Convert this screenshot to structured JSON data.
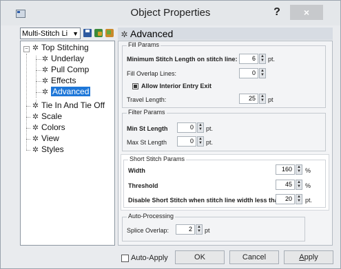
{
  "window": {
    "title": "Object Properties",
    "help_label": "?",
    "close_label": "×"
  },
  "left": {
    "combo_value": "Multi-Stitch Li",
    "tree": {
      "root": "Top Stitching",
      "children": [
        "Underlay",
        "Pull Comp",
        "Effects",
        "Advanced"
      ],
      "others": [
        "Tie In And Tie Off",
        "Scale",
        "Colors",
        "View",
        "Styles"
      ]
    }
  },
  "right": {
    "header": "Advanced",
    "fill_params": {
      "title": "Fill Params",
      "min_stitch_label": "Minimum Stitch Length on stitch line:",
      "min_stitch_value": "6",
      "min_stitch_unit": "pt.",
      "overlap_label": "Fill Overlap Lines:",
      "overlap_value": "0",
      "interior_label": "Allow Interior Entry Exit",
      "travel_label": "Travel Length:",
      "travel_value": "25",
      "travel_unit": "pt"
    },
    "filter_params": {
      "title": "Filter Params",
      "min_label": "Min St Length",
      "min_value": "0",
      "min_unit": "pt.",
      "max_label": "Max St Length",
      "max_value": "0",
      "max_unit": "pt."
    },
    "short_stitch": {
      "title": "Short Stitch Params",
      "width_label": "Width",
      "width_value": "160",
      "width_unit": "%",
      "threshold_label": "Threshold",
      "threshold_value": "45",
      "threshold_unit": "%",
      "disable_label": "Disable Short Stitch when stitch line width less than",
      "disable_value": "20",
      "disable_unit": "pt."
    },
    "auto": {
      "title": "Auto-Processing",
      "splice_label": "Splice Overlap:",
      "splice_value": "2",
      "splice_unit": "pt"
    }
  },
  "footer": {
    "auto_apply": "Auto-Apply",
    "ok": "OK",
    "cancel": "Cancel",
    "apply_first": "A",
    "apply_rest": "pply"
  }
}
